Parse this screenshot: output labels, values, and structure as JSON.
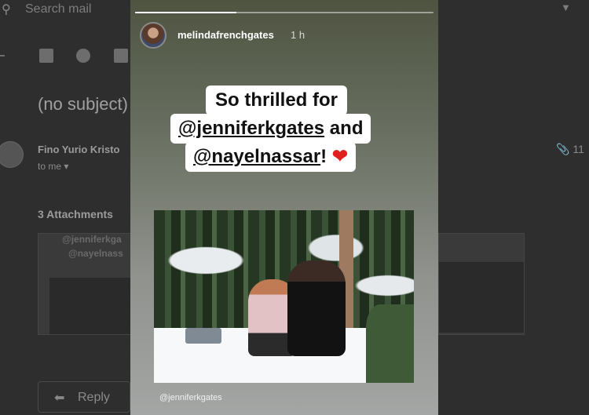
{
  "gmail": {
    "search_placeholder": "Search mail",
    "subject": "(no subject)",
    "sender": "Fino Yurio Kristo",
    "recipient": "to me",
    "attachment_count_label": "11",
    "attachments_heading": "3 Attachments",
    "thumb_line1": "@jenniferkga",
    "thumb_line2": "@nayelnass",
    "reply_label": "Reply",
    "icons": [
      "search-icon",
      "archive-icon",
      "report-spam-icon",
      "trash-icon",
      "paperclip-icon",
      "reply-icon",
      "chevron-down-icon"
    ]
  },
  "story": {
    "username": "melindafrenchgates",
    "time": "1 h",
    "progress_fraction": 0.34,
    "caption_line1": "So thrilled for",
    "caption_mention1": "@jenniferkgates",
    "caption_and": " and",
    "caption_mention2": "@nayelnassar",
    "caption_bang": "!",
    "heart": "❤",
    "photo_credit": "@jenniferkgates"
  },
  "colors": {
    "heart": "#e0201f",
    "story_top": "#4e5440",
    "story_bottom": "#a3a6a4"
  }
}
